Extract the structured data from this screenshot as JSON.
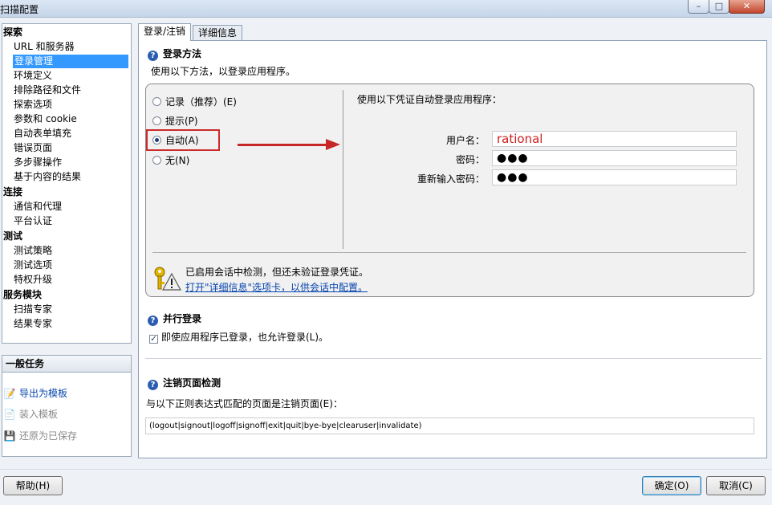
{
  "window": {
    "title": "扫描配置",
    "controls": {
      "minimize": "–",
      "maximize": "□",
      "close": "✕"
    }
  },
  "nav": {
    "categories": [
      {
        "label": "探索",
        "items": [
          "URL 和服务器",
          "登录管理",
          "环境定义",
          "排除路径和文件",
          "探索选项",
          "参数和 cookie",
          "自动表单填充",
          "错误页面",
          "多步骤操作",
          "基于内容的结果"
        ]
      },
      {
        "label": "连接",
        "items": [
          "通信和代理",
          "平台认证"
        ]
      },
      {
        "label": "测试",
        "items": [
          "测试策略",
          "测试选项",
          "特权升级"
        ]
      },
      {
        "label": "服务模块",
        "items": [
          "扫描专家",
          "结果专家"
        ]
      }
    ],
    "selected": "登录管理"
  },
  "tasks": {
    "header": "一般任务",
    "items": [
      {
        "label": "导出为模板",
        "icon": "export-icon",
        "enabled": true
      },
      {
        "label": "装入模板",
        "icon": "load-template-icon",
        "enabled": false
      },
      {
        "label": "还原为已保存",
        "icon": "restore-icon",
        "enabled": false
      }
    ]
  },
  "tabs": [
    {
      "label": "登录/注销",
      "active": true
    },
    {
      "label": "详细信息",
      "active": false
    }
  ],
  "login_method": {
    "title": "登录方法",
    "description": "使用以下方法，以登录应用程序。",
    "options": [
      {
        "label": "记录（推荐）(E)",
        "checked": false
      },
      {
        "label": "提示(P)",
        "checked": false
      },
      {
        "label": "自动(A)",
        "checked": true
      },
      {
        "label": "无(N)",
        "checked": false
      }
    ],
    "credentials_caption": "使用以下凭证自动登录应用程序：",
    "username_label": "用户名：",
    "username_value": "rational",
    "password_label": "密码：",
    "password_value": "●●●",
    "confirm_label": "重新输入密码：",
    "confirm_value": "●●●",
    "warning_text": "已启用会话中检测，但还未验证登录凭证。",
    "warning_link": "打开\"详细信息\"选项卡，以供会话中配置。"
  },
  "concurrent_login": {
    "title": "并行登录",
    "checkbox_label": "即使应用程序已登录，也允许登录(L)。",
    "checked": true
  },
  "logout_detection": {
    "title": "注销页面检测",
    "description": "与以下正则表达式匹配的页面是注销页面(E)：",
    "regex": "(logout|signout|logoff|signoff|exit|quit|bye-bye|clearuser|invalidate)"
  },
  "buttons": {
    "help": "帮助(H)",
    "ok": "确定(O)",
    "cancel": "取消(C)"
  },
  "colors": {
    "selection": "#3399ff",
    "link": "#0645ad",
    "highlight": "#cc2b2b"
  }
}
